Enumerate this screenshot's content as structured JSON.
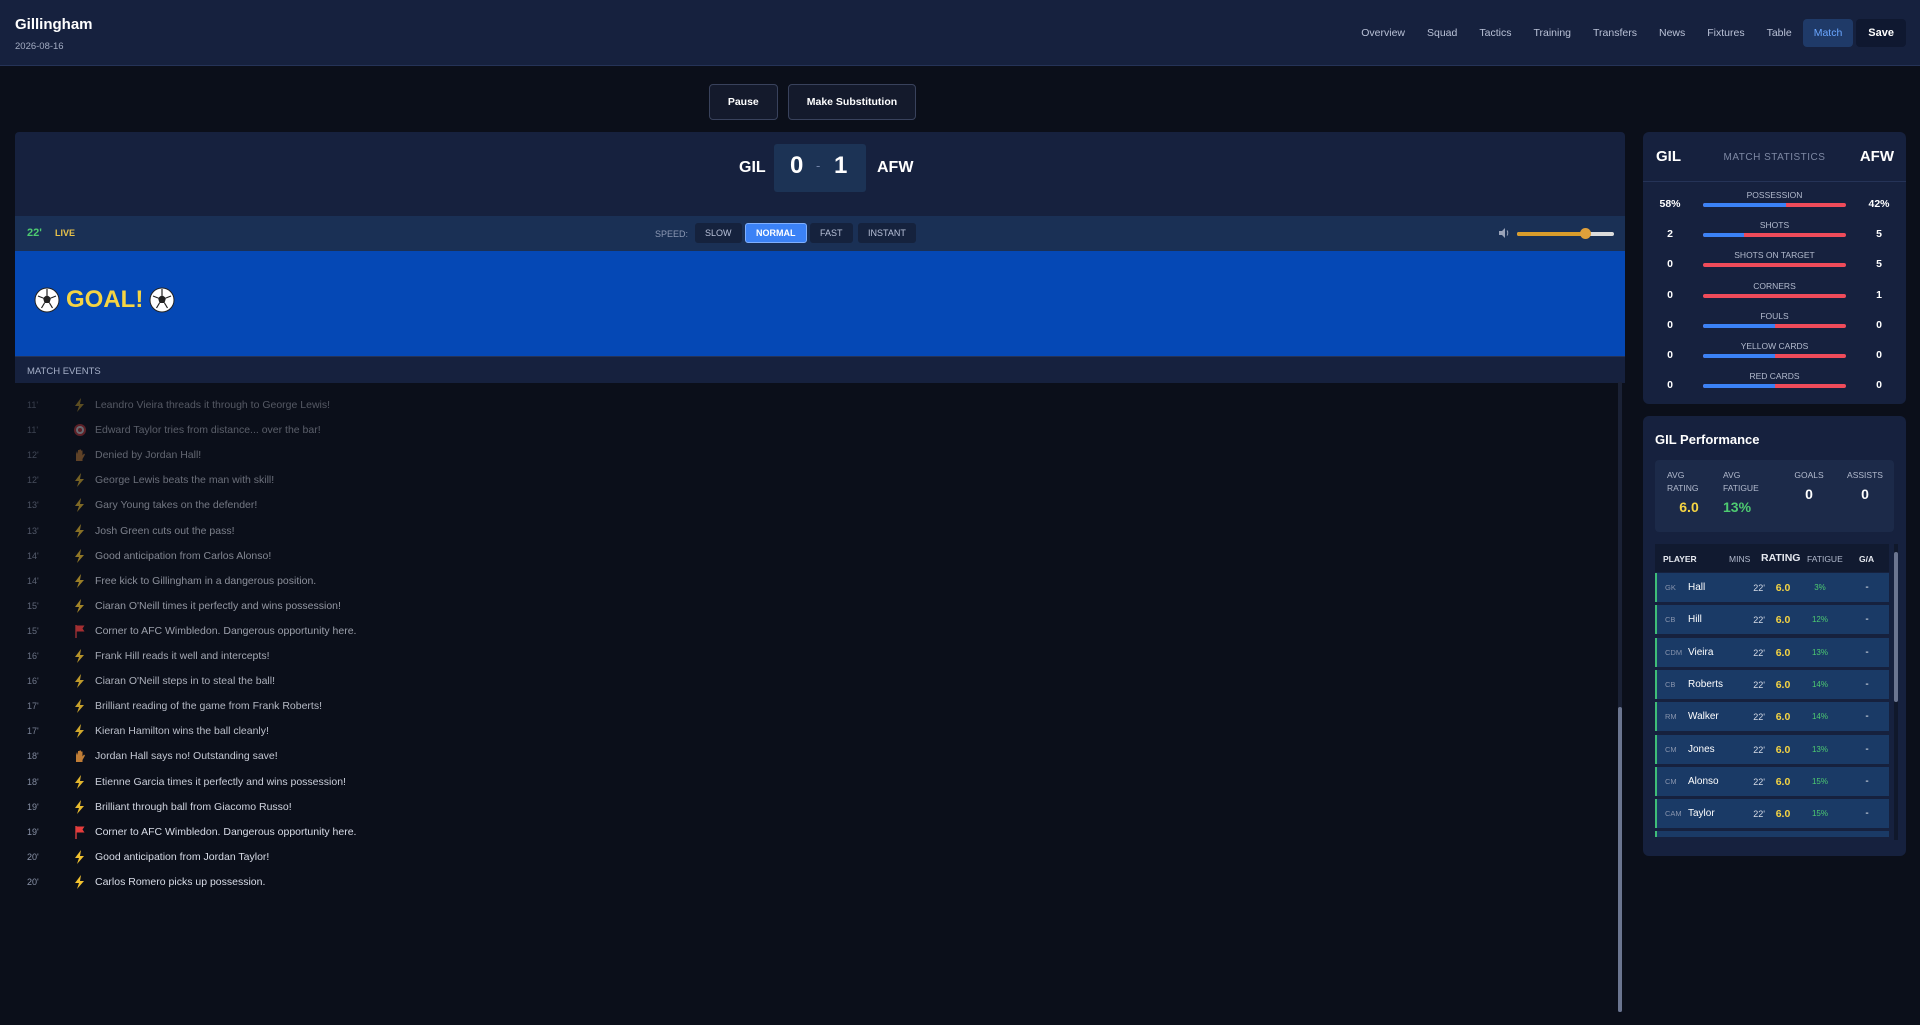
{
  "header": {
    "club": "Gillingham",
    "date": "2026-08-16",
    "nav": [
      "Overview",
      "Squad",
      "Tactics",
      "Training",
      "Transfers",
      "News",
      "Fixtures",
      "Table",
      "Match"
    ],
    "save": "Save"
  },
  "actions": {
    "pause": "Pause",
    "substitution": "Make Substitution"
  },
  "scoreboard": {
    "home": "GIL",
    "away": "AFW",
    "home_score": "0",
    "away_score": "1",
    "separator": "-"
  },
  "control": {
    "minute": "22'",
    "live": "LIVE",
    "speed_label": "SPEED:",
    "speeds": [
      "SLOW",
      "NORMAL",
      "FAST",
      "INSTANT"
    ],
    "active_speed": "NORMAL",
    "volume": 0.7
  },
  "goal_banner": {
    "text": "GOAL!"
  },
  "events": {
    "title": "MATCH EVENTS",
    "items": [
      {
        "minute": "11'",
        "icon": "bolt",
        "text": "Leandro Vieira threads it through to George Lewis!",
        "dim": 0.35
      },
      {
        "minute": "11'",
        "icon": "target",
        "text": "Edward Taylor tries from distance... over the bar!",
        "dim": 0.38
      },
      {
        "minute": "12'",
        "icon": "glove",
        "text": "Denied by Jordan Hall!",
        "dim": 0.42
      },
      {
        "minute": "12'",
        "icon": "bolt",
        "text": "George Lewis beats the man with skill!",
        "dim": 0.46
      },
      {
        "minute": "13'",
        "icon": "bolt",
        "text": "Gary Young takes on the defender!",
        "dim": 0.5
      },
      {
        "minute": "13'",
        "icon": "bolt",
        "text": "Josh Green cuts out the pass!",
        "dim": 0.54
      },
      {
        "minute": "14'",
        "icon": "bolt",
        "text": "Good anticipation from Carlos Alonso!",
        "dim": 0.58
      },
      {
        "minute": "14'",
        "icon": "bolt",
        "text": "Free kick to Gillingham in a dangerous position.",
        "dim": 0.62
      },
      {
        "minute": "15'",
        "icon": "bolt",
        "text": "Ciaran O'Neill times it perfectly and wins possession!",
        "dim": 0.66
      },
      {
        "minute": "15'",
        "icon": "flag",
        "text": "Corner to AFC Wimbledon. Dangerous opportunity here.",
        "dim": 0.7
      },
      {
        "minute": "16'",
        "icon": "bolt",
        "text": "Frank Hill reads it well and intercepts!",
        "dim": 0.74
      },
      {
        "minute": "16'",
        "icon": "bolt",
        "text": "Ciaran O'Neill steps in to steal the ball!",
        "dim": 0.78
      },
      {
        "minute": "17'",
        "icon": "bolt",
        "text": "Brilliant reading of the game from Frank Roberts!",
        "dim": 0.82
      },
      {
        "minute": "17'",
        "icon": "bolt",
        "text": "Kieran Hamilton wins the ball cleanly!",
        "dim": 0.86
      },
      {
        "minute": "18'",
        "icon": "glove",
        "text": "Jordan Hall says no! Outstanding save!",
        "dim": 0.9
      },
      {
        "minute": "18'",
        "icon": "bolt",
        "text": "Etienne Garcia times it perfectly and wins possession!",
        "dim": 0.93
      },
      {
        "minute": "19'",
        "icon": "bolt",
        "text": "Brilliant through ball from Giacomo Russo!",
        "dim": 0.96
      },
      {
        "minute": "19'",
        "icon": "flag",
        "text": "Corner to AFC Wimbledon. Dangerous opportunity here.",
        "dim": 1
      },
      {
        "minute": "20'",
        "icon": "bolt",
        "text": "Good anticipation from Jordan Taylor!",
        "dim": 1
      },
      {
        "minute": "20'",
        "icon": "bolt",
        "text": "Carlos Romero picks up possession.",
        "dim": 1
      }
    ]
  },
  "stats": {
    "home": "GIL",
    "away": "AFW",
    "title": "MATCH STATISTICS",
    "rows": [
      {
        "label": "POSSESSION",
        "home": "58%",
        "away": "42%",
        "home_share": 0.58
      },
      {
        "label": "SHOTS",
        "home": "2",
        "away": "5",
        "home_share": 0.29
      },
      {
        "label": "SHOTS ON TARGET",
        "home": "0",
        "away": "5",
        "home_share": 0
      },
      {
        "label": "CORNERS",
        "home": "0",
        "away": "1",
        "home_share": 0
      },
      {
        "label": "FOULS",
        "home": "0",
        "away": "0",
        "home_share": 0.5
      },
      {
        "label": "YELLOW CARDS",
        "home": "0",
        "away": "0",
        "home_share": 0.5
      },
      {
        "label": "RED CARDS",
        "home": "0",
        "away": "0",
        "home_share": 0.5
      }
    ]
  },
  "performance": {
    "title": "GIL Performance",
    "summary": {
      "avg_rating_label": "AVG RATING",
      "avg_rating": "6.0",
      "avg_fatigue_label": "AVG FATIGUE",
      "avg_fatigue": "13%",
      "goals_label": "GOALS",
      "goals": "0",
      "assists_label": "ASSISTS",
      "assists": "0"
    },
    "columns": {
      "player": "PLAYER",
      "mins": "MINS",
      "rating": "RATING",
      "fatigue": "FATIGUE",
      "ga": "G/A"
    },
    "players": [
      {
        "pos": "GK",
        "name": "Hall",
        "mins": "22'",
        "rating": "6.0",
        "fatigue": "3%",
        "ga": "-"
      },
      {
        "pos": "CB",
        "name": "Hill",
        "mins": "22'",
        "rating": "6.0",
        "fatigue": "12%",
        "ga": "-"
      },
      {
        "pos": "CDM",
        "name": "Vieira",
        "mins": "22'",
        "rating": "6.0",
        "fatigue": "13%",
        "ga": "-"
      },
      {
        "pos": "CB",
        "name": "Roberts",
        "mins": "22'",
        "rating": "6.0",
        "fatigue": "14%",
        "ga": "-"
      },
      {
        "pos": "RM",
        "name": "Walker",
        "mins": "22'",
        "rating": "6.0",
        "fatigue": "14%",
        "ga": "-"
      },
      {
        "pos": "CM",
        "name": "Jones",
        "mins": "22'",
        "rating": "6.0",
        "fatigue": "13%",
        "ga": "-"
      },
      {
        "pos": "CM",
        "name": "Alonso",
        "mins": "22'",
        "rating": "6.0",
        "fatigue": "15%",
        "ga": "-"
      },
      {
        "pos": "CAM",
        "name": "Taylor",
        "mins": "22'",
        "rating": "6.0",
        "fatigue": "15%",
        "ga": "-"
      }
    ]
  },
  "colors": {
    "home": "#3b82f6",
    "away": "#ef4b5a",
    "accent": "#f5d443",
    "banner": "#0548b5"
  }
}
